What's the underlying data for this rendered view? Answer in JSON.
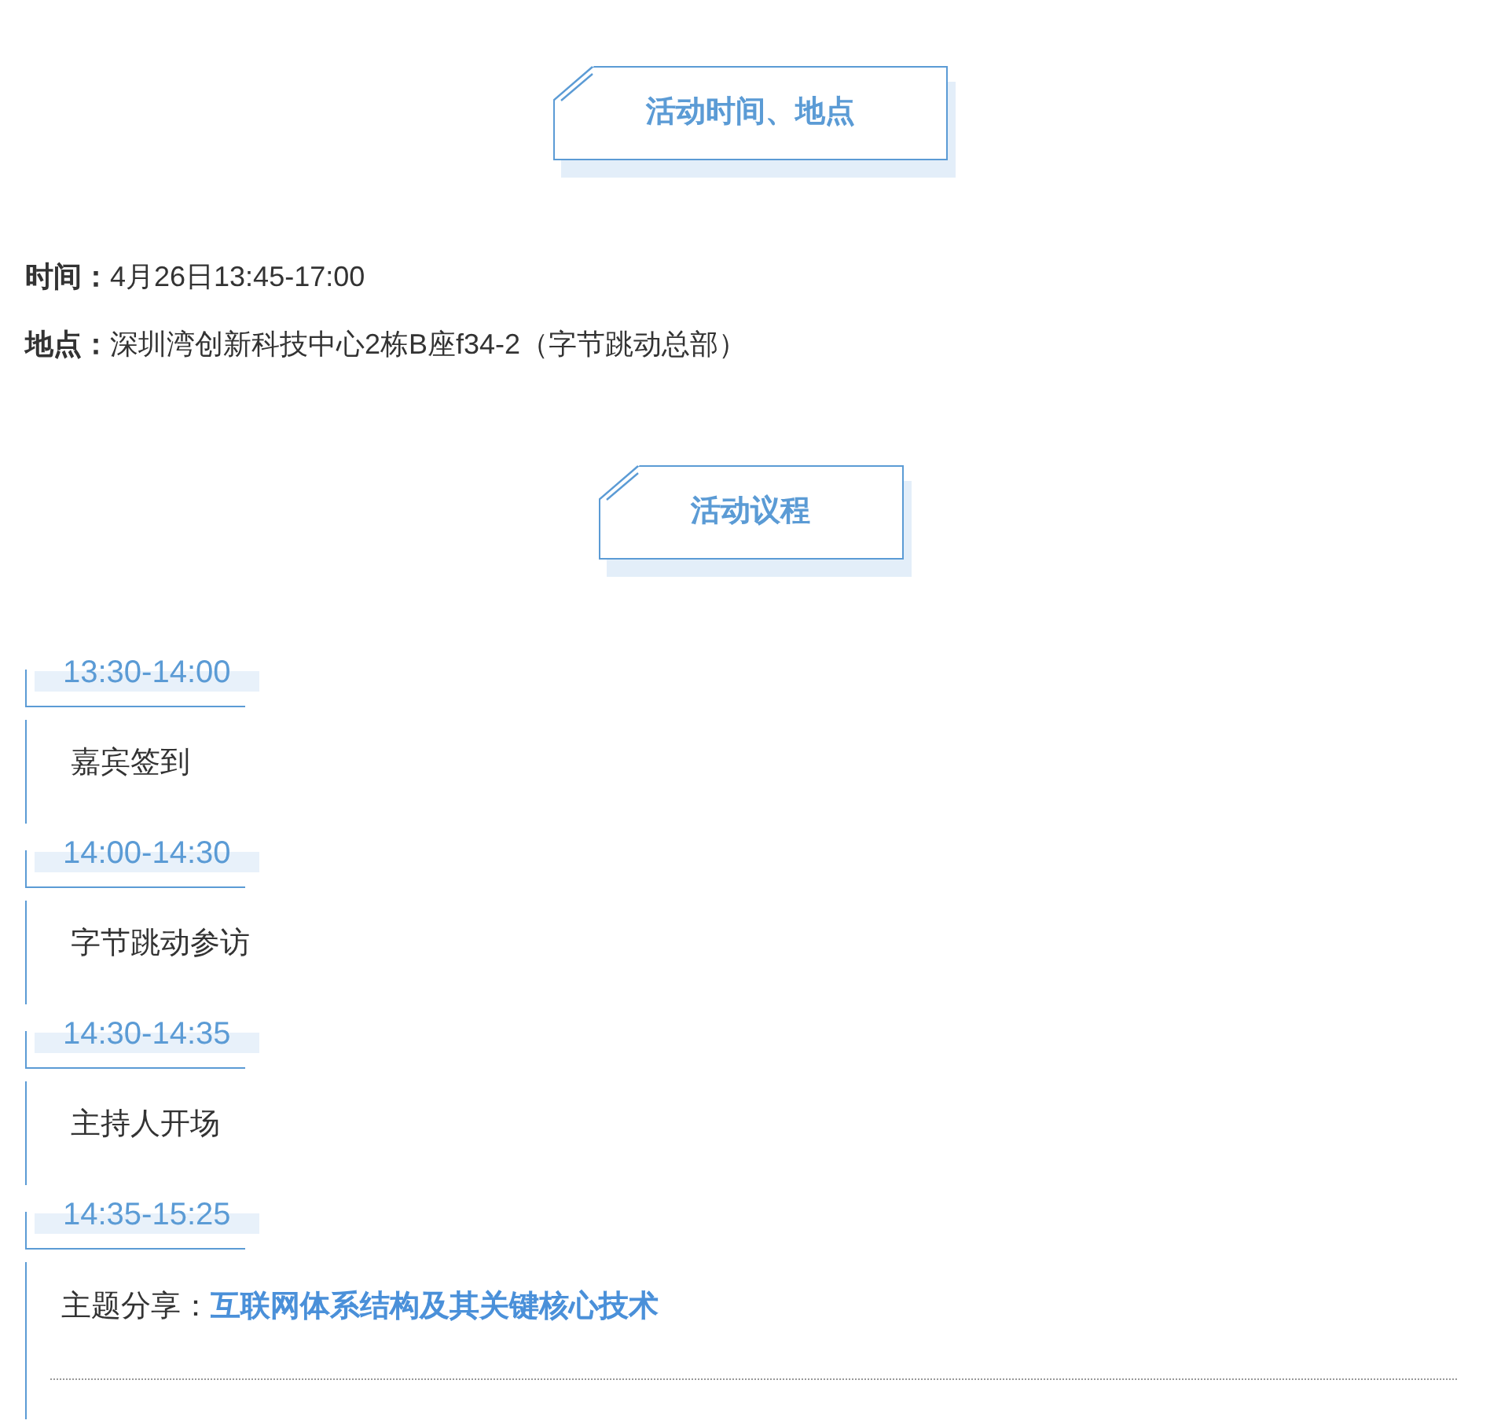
{
  "sections": [
    {
      "heading": "活动时间、地点",
      "kind": "info",
      "rows": [
        {
          "label": "时间：",
          "value": "4月26日13:45-17:00"
        },
        {
          "label": "地点：",
          "value": "深圳湾创新科技中心2栋B座f34-2（字节跳动总部）"
        }
      ]
    },
    {
      "heading": "活动议程",
      "kind": "agenda",
      "items": [
        {
          "time": "13:30-14:00",
          "kind": "plain",
          "text": "嘉宾签到"
        },
        {
          "time": "14:00-14:30",
          "kind": "plain",
          "text": "字节跳动参访"
        },
        {
          "time": "14:30-14:35",
          "kind": "plain",
          "text": "主持人开场"
        },
        {
          "time": "14:35-15:25",
          "kind": "talk",
          "label": "主题分享：",
          "title": "互联网体系结构及其关键核心技术"
        }
      ]
    }
  ]
}
